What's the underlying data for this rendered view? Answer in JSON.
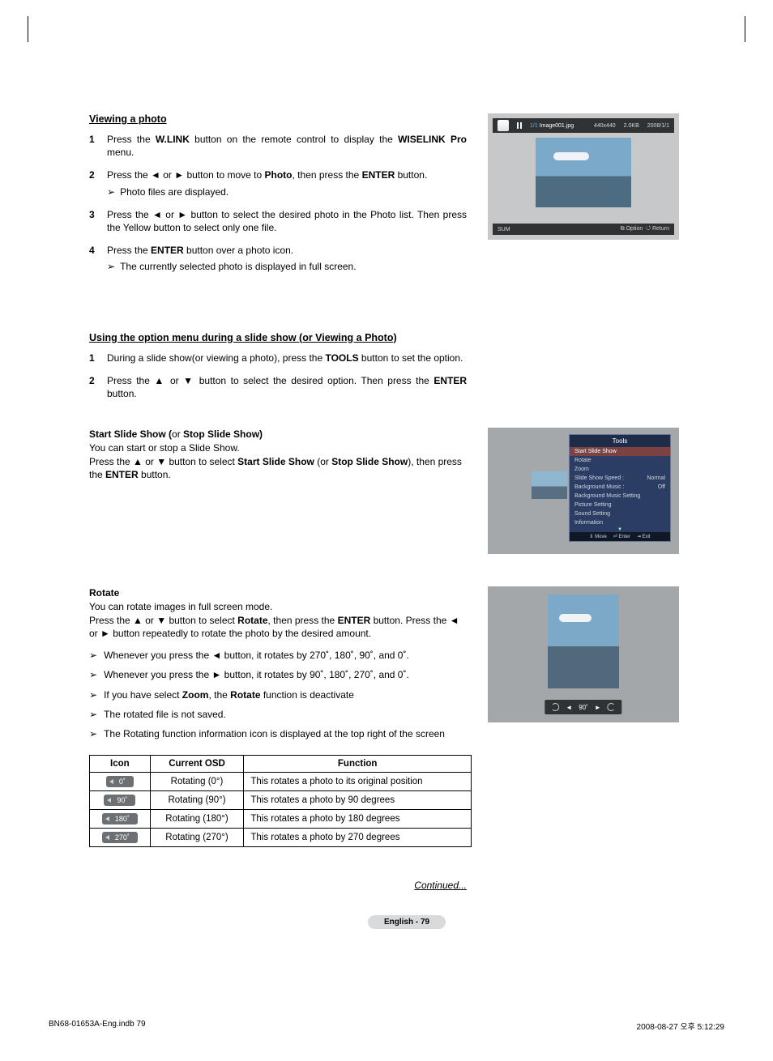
{
  "section_view": {
    "title": "Viewing a photo",
    "steps": [
      {
        "num": "1",
        "parts": [
          "Press the ",
          "W.LINK",
          " button on the remote control to display the ",
          "WISELINK Pro",
          " menu."
        ]
      },
      {
        "num": "2",
        "parts": [
          "Press the ◄ or ► button to move to ",
          "Photo",
          ", then press the ",
          "ENTER",
          " button."
        ],
        "sub": "Photo files are displayed."
      },
      {
        "num": "3",
        "parts": [
          "Press the ◄ or ► button to select the desired photo in the Photo list. Then press the Yellow button to select only one file."
        ]
      },
      {
        "num": "4",
        "parts": [
          "Press the ",
          "ENTER",
          " button over a photo icon."
        ],
        "sub": "The currently selected photo is displayed in full screen."
      }
    ]
  },
  "section_option": {
    "title": "Using the option menu during a slide show (or Viewing a Photo)",
    "steps": [
      {
        "num": "1",
        "parts": [
          "During a slide show(or viewing a photo), press the ",
          "TOOLS",
          " button to set the option."
        ]
      },
      {
        "num": "2",
        "parts": [
          "Press the ▲ or ▼ button to select the desired option. Then press the ",
          "ENTER",
          " button."
        ]
      }
    ]
  },
  "start_slide": {
    "head_a": "Start Slide Show (",
    "head_b": "or ",
    "head_c": "Stop Slide Show)",
    "body1": "You can start or stop a Slide Show.",
    "body2_a": "Press the ▲ or ▼ button to select ",
    "body2_b": "Start Slide Show",
    "body2_c": " (or ",
    "body2_d": "Stop Slide Show",
    "body2_e": "), then press the ",
    "body2_f": "ENTER",
    "body2_g": " button."
  },
  "rotate": {
    "head": "Rotate",
    "body1": "You can rotate images in full screen mode.",
    "body2_a": "Press the ▲ or ▼ button to select ",
    "body2_b": "Rotate",
    "body2_c": ", then press the ",
    "body2_d": "ENTER",
    "body2_e": " button. Press the ◄ or ► button repeatedly to rotate the photo by the desired amount.",
    "bullets": [
      "Whenever you press the ◄ button, it rotates by 270˚, 180˚, 90˚, and 0˚.",
      "Whenever you press the ► button, it rotates by 90˚, 180˚, 270˚, and 0˚.",
      [
        "If you have select ",
        "Zoom",
        ", the ",
        "Rotate",
        " function is deactivate"
      ],
      "The rotated file is not saved.",
      "The Rotating function information icon is displayed at the top right of the screen"
    ],
    "table": {
      "headers": [
        "Icon",
        "Current OSD",
        "Function"
      ],
      "rows": [
        {
          "icon": "0˚",
          "osd": "Rotating (0°)",
          "fn": "This rotates a photo to its original position"
        },
        {
          "icon": "90˚",
          "osd": "Rotating (90°)",
          "fn": "This rotates a photo by 90 degrees"
        },
        {
          "icon": "180˚",
          "osd": "Rotating (180°)",
          "fn": "This rotates a photo by 180 degrees"
        },
        {
          "icon": "270˚",
          "osd": "Rotating (270°)",
          "fn": "This rotates a photo by 270 degrees"
        }
      ]
    }
  },
  "preview1": {
    "idx": "1/1",
    "filename": "Image001.jpg",
    "dim": "440x440",
    "size": "2.0KB",
    "date": "2008/1/1",
    "sum": "SUM",
    "option": "Option",
    "return": "Return"
  },
  "preview2": {
    "title": "Tools",
    "items": [
      {
        "label": "Start Slide Show",
        "hl": true
      },
      {
        "label": "Rotate"
      },
      {
        "label": "Zoom"
      },
      {
        "label": "Slide Show Speed",
        "val": "Normal",
        "sep": ":"
      },
      {
        "label": "Background Music",
        "val": "Off",
        "sep": ":"
      },
      {
        "label": "Background Music Setting"
      },
      {
        "label": "Picture Setting"
      },
      {
        "label": "Sound Setting"
      },
      {
        "label": "Information"
      }
    ],
    "footer": {
      "move": "Move",
      "enter": "Enter",
      "exit": "Exit"
    }
  },
  "preview3": {
    "angle": "90˚"
  },
  "continued": "Continued...",
  "page_label": "English - 79",
  "print_foot": {
    "left": "BN68-01653A-Eng.indb   79",
    "right": "2008-08-27   오후 5:12:29"
  },
  "glyph": {
    "sub_arrow": "➢",
    "opt_icon": "⧉",
    "ret_icon": "↺",
    "enter_icon": "⏎",
    "exit_icon": "⇥",
    "updown": "⇕",
    "tri_l": "◄",
    "tri_r": "►"
  }
}
